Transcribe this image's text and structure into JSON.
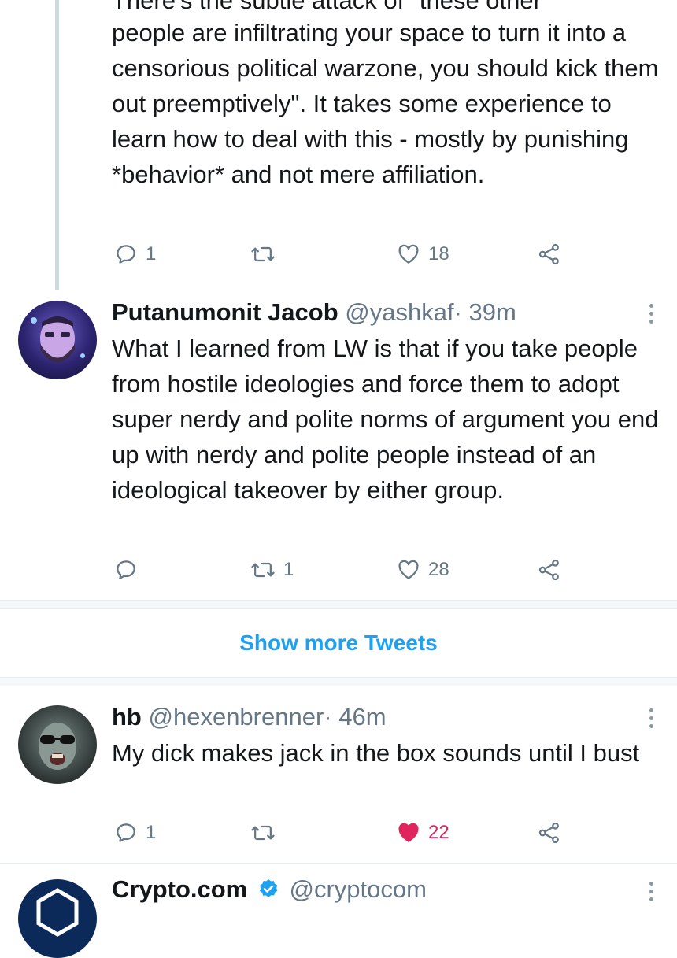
{
  "tweets": [
    {
      "text_partial_top": "There's the subtle attack of \"these other",
      "text": "people are infiltrating your space to turn it into a censorious political warzone, you should kick them out preemptively\". It takes some experience to learn how to deal with this - mostly by punishing *behavior* and not mere affiliation.",
      "replies": "1",
      "retweets": "",
      "likes": "18"
    },
    {
      "name": "Putanumonit Jacob",
      "handle": "@yashkaf",
      "time": "· 39m",
      "text": "What I learned from LW is that if you take people from hostile ideologies and force them to adopt super nerdy and polite norms of argument you end up with nerdy and polite people instead of an ideological takeover by either group.",
      "replies": "",
      "retweets": "1",
      "likes": "28"
    },
    {
      "name": "hb",
      "handle": "@hexenbrenner",
      "time": "· 46m",
      "text": "My dick makes jack in the box sounds until I bust",
      "replies": "1",
      "retweets": "",
      "likes": "22",
      "liked": true
    },
    {
      "name": "Crypto.com",
      "handle": "@cryptocom",
      "verified": true
    }
  ],
  "show_more_label": "Show more Tweets",
  "colors": {
    "accent": "#1da1f2",
    "like_active": "#e0245e",
    "muted": "#657786",
    "divider": "#e6ecf0"
  },
  "icons": {
    "reply": "reply-icon",
    "retweet": "retweet-icon",
    "like": "heart-icon",
    "share": "share-icon",
    "more": "more-vertical-icon",
    "verified": "verified-badge-icon"
  }
}
